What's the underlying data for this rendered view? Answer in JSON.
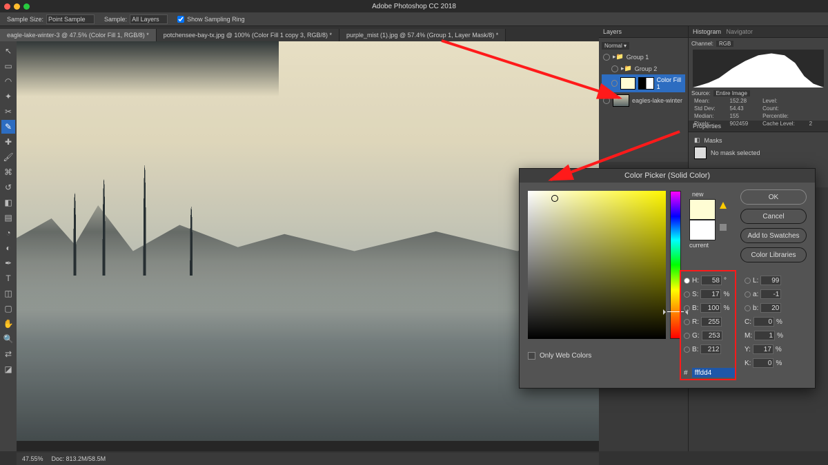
{
  "app": {
    "title": "Adobe Photoshop CC 2018"
  },
  "options": {
    "sample_size_label": "Sample Size:",
    "sample_size_value": "Point Sample",
    "sample_label": "Sample:",
    "sample_value": "All Layers",
    "show_ring_label": "Show Sampling Ring"
  },
  "tabs": [
    {
      "label": "eagle-lake-winter-3 @ 47.5% (Color Fill 1, RGB/8) *",
      "active": true
    },
    {
      "label": "potchensee-bay-tx.jpg @ 100% (Color Fill 1 copy 3, RGB/8) *",
      "active": false
    },
    {
      "label": "purple_mist (1).jpg @ 57.4% (Group 1, Layer Mask/8) *",
      "active": false
    }
  ],
  "layers_panel": {
    "title": "Layers",
    "items": [
      {
        "name": "Group 1",
        "kind": "group"
      },
      {
        "name": "Group 2",
        "kind": "group",
        "indent": 1
      },
      {
        "name": "Color Fill 1",
        "kind": "fill",
        "selected": true,
        "indent": 1
      },
      {
        "name": "eagles-lake-winter",
        "kind": "image"
      }
    ]
  },
  "histogram_panel": {
    "title": "Histogram",
    "nav_title": "Navigator",
    "channel_label": "Channel:",
    "channel_value": "RGB",
    "source_label": "Source:",
    "source_value": "Entire Image",
    "stats": {
      "mean_label": "Mean:",
      "mean": "152.28",
      "std_label": "Std Dev:",
      "std": "54.43",
      "median_label": "Median:",
      "median": "155",
      "pixels_label": "Pixels:",
      "pixels": "902459",
      "level_label": "Level:",
      "count_label": "Count:",
      "percentile_label": "Percentile:",
      "cache_label": "Cache Level:",
      "cache": "2"
    }
  },
  "properties_panel": {
    "title": "Properties",
    "masks_label": "Masks",
    "no_mask": "No mask selected"
  },
  "statusbar": {
    "zoom": "47.55%",
    "doc": "Doc: 813.2M/58.5M"
  },
  "color_picker": {
    "title": "Color Picker (Solid Color)",
    "ok": "OK",
    "cancel": "Cancel",
    "add_swatch": "Add to Swatches",
    "libraries": "Color Libraries",
    "new_label": "new",
    "current_label": "current",
    "only_web": "Only Web Colors",
    "hsb": {
      "H": "58",
      "S": "17",
      "B": "100"
    },
    "rgb": {
      "R": "255",
      "G": "253",
      "B": "212"
    },
    "lab": {
      "L": "99",
      "a": "-1",
      "b": "20"
    },
    "cmyk": {
      "C": "0",
      "M": "1",
      "Y": "17",
      "K": "0"
    },
    "hex_prefix": "#",
    "hex": "fffdd4",
    "labels": {
      "H": "H:",
      "S": "S:",
      "Bri": "B:",
      "R": "R:",
      "G": "G:",
      "Bb": "B:",
      "L": "L:",
      "a": "a:",
      "b": "b:",
      "C": "C:",
      "M": "M:",
      "Y": "Y:",
      "K": "K:",
      "deg": "°",
      "pct": "%"
    }
  }
}
